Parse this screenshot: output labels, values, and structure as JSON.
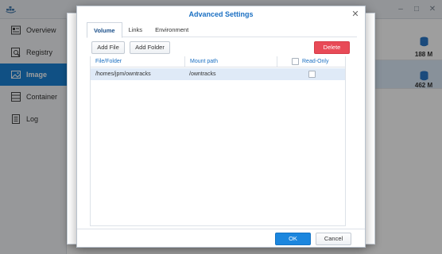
{
  "app": {
    "sidebar": [
      {
        "label": "Overview",
        "icon": "overview-icon"
      },
      {
        "label": "Registry",
        "icon": "registry-icon"
      },
      {
        "label": "Image",
        "icon": "image-icon"
      },
      {
        "label": "Container",
        "icon": "container-icon"
      },
      {
        "label": "Log",
        "icon": "log-icon"
      }
    ],
    "images": [
      {
        "size": "188 M"
      },
      {
        "size": "462 M"
      }
    ],
    "window_controls": [
      "–",
      "□",
      "✕"
    ]
  },
  "dialog": {
    "title": "Advanced Settings",
    "close_glyph": "✕",
    "tabs": [
      "Volume",
      "Links",
      "Environment"
    ],
    "active_tab": "Volume",
    "buttons": {
      "add_file": "Add File",
      "add_folder": "Add Folder",
      "delete": "Delete",
      "ok": "OK",
      "cancel": "Cancel"
    },
    "table": {
      "columns": [
        "File/Folder",
        "Mount path",
        "Read-Only"
      ],
      "rows": [
        {
          "file_folder": "/homes/jpm/owntracks",
          "mount_path": "/owntracks",
          "read_only": false
        }
      ]
    }
  },
  "colors": {
    "accent": "#1a82d6",
    "title": "#1a6fc2",
    "delete": "#e84a57",
    "selected_row": "#dfeaf7"
  }
}
